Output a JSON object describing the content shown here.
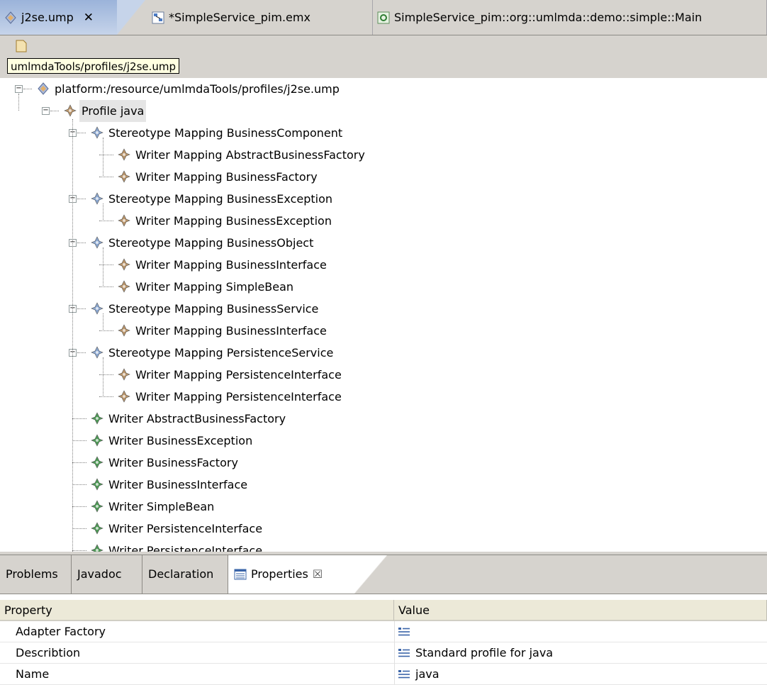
{
  "editor_tabs": [
    {
      "label": "j2se.ump",
      "close": "✕",
      "icon": "profile-icon",
      "active": true
    },
    {
      "label": "*SimpleService_pim.emx",
      "icon": "model-icon",
      "active": false
    },
    {
      "label": "SimpleService_pim::org::umlmda::demo::simple::Main",
      "icon": "diagram-icon",
      "active": false
    }
  ],
  "tooltip": "umlmdaTools/profiles/j2se.ump",
  "tree": {
    "root": "platform:/resource/umlmdaTools/profiles/j2se.ump",
    "profile": "Profile java",
    "stereotypes": [
      {
        "label": "Stereotype Mapping BusinessComponent",
        "writers": [
          "Writer Mapping AbstractBusinessFactory",
          "Writer Mapping BusinessFactory"
        ]
      },
      {
        "label": "Stereotype Mapping BusinessException",
        "writers": [
          "Writer Mapping BusinessException"
        ]
      },
      {
        "label": "Stereotype Mapping BusinessObject",
        "writers": [
          "Writer Mapping BusinessInterface",
          "Writer Mapping SimpleBean"
        ]
      },
      {
        "label": "Stereotype Mapping BusinessService",
        "writers": [
          "Writer Mapping BusinessInterface"
        ]
      },
      {
        "label": "Stereotype Mapping PersistenceService",
        "writers": [
          "Writer Mapping PersistenceInterface",
          "Writer Mapping PersistenceInterface"
        ]
      }
    ],
    "writers": [
      "Writer AbstractBusinessFactory",
      "Writer BusinessException",
      "Writer BusinessFactory",
      "Writer BusinessInterface",
      "Writer SimpleBean",
      "Writer PersistenceInterface"
    ]
  },
  "view_tabs": [
    {
      "label": "Problems",
      "active": false
    },
    {
      "label": "Javadoc",
      "active": false
    },
    {
      "label": "Declaration",
      "active": false
    },
    {
      "label": "Properties",
      "close": "☒",
      "active": true
    }
  ],
  "properties": {
    "header": {
      "property": "Property",
      "value": "Value"
    },
    "rows": [
      {
        "name": "Adapter Factory",
        "value": ""
      },
      {
        "name": "Describtion",
        "value": "Standard profile for java"
      },
      {
        "name": "Name",
        "value": "java"
      }
    ]
  },
  "colors": {
    "tab_active": "#c6d4ea",
    "chrome": "#d6d3ce",
    "diamond_tan": "#b8946a",
    "diamond_blue": "#8aa6cf",
    "diamond_green": "#4f9a57"
  }
}
